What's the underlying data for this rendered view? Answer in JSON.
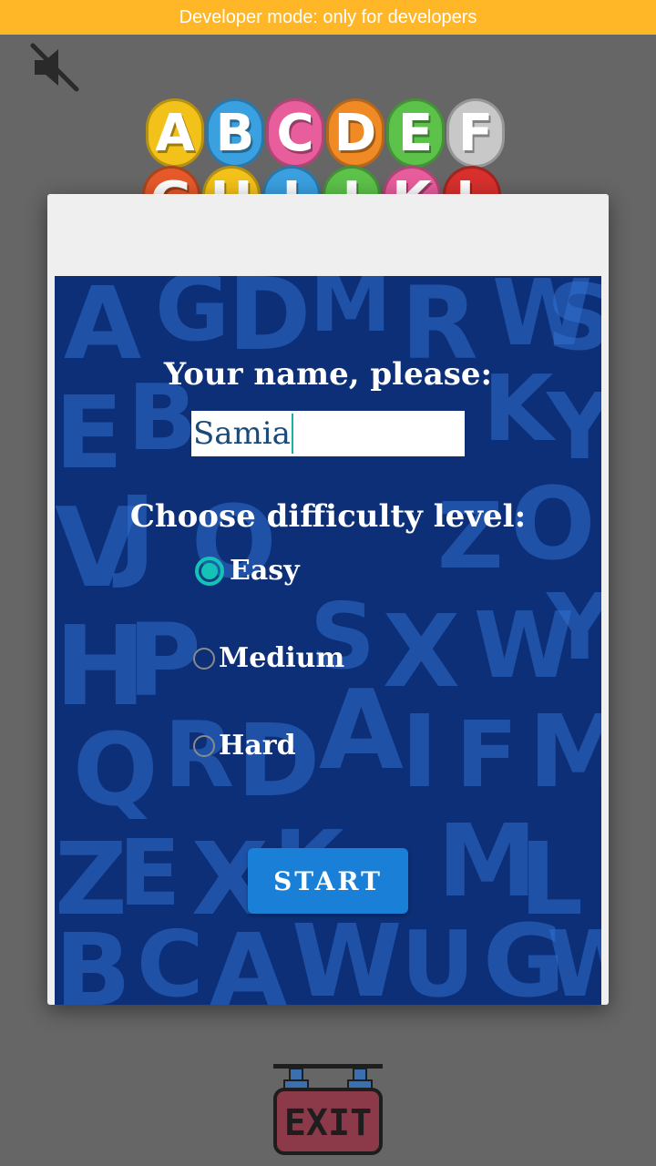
{
  "dev_banner": "Developer mode: only for developers",
  "icons": {
    "sound": "volume-off-icon",
    "logo": "alphabet-logo",
    "exit": "exit-sign-icon"
  },
  "logo": {
    "row1": [
      "A",
      "B",
      "C",
      "D",
      "E",
      "F"
    ],
    "row2": [
      "G",
      "H",
      "I",
      "J",
      "K",
      "L"
    ],
    "colors": [
      "#f2c21a",
      "#3aa0e0",
      "#e85d9c",
      "#f08a24",
      "#5cc24a",
      "#c8c8c8"
    ]
  },
  "form": {
    "name_prompt": "Your name, please:",
    "name_value": "Samia",
    "level_title": "Choose difficulty level:",
    "levels": [
      {
        "label": "Easy",
        "selected": true
      },
      {
        "label": "Medium",
        "selected": false
      },
      {
        "label": "Hard",
        "selected": false
      }
    ],
    "start_label": "START"
  },
  "exit_label": "EXIT",
  "colors": {
    "banner": "#ffb627",
    "overlay": "#666666",
    "panel": "#0c2f77",
    "accent": "#14c2b6",
    "button": "#1a7fd6",
    "exit_board": "#8c3a4a"
  }
}
